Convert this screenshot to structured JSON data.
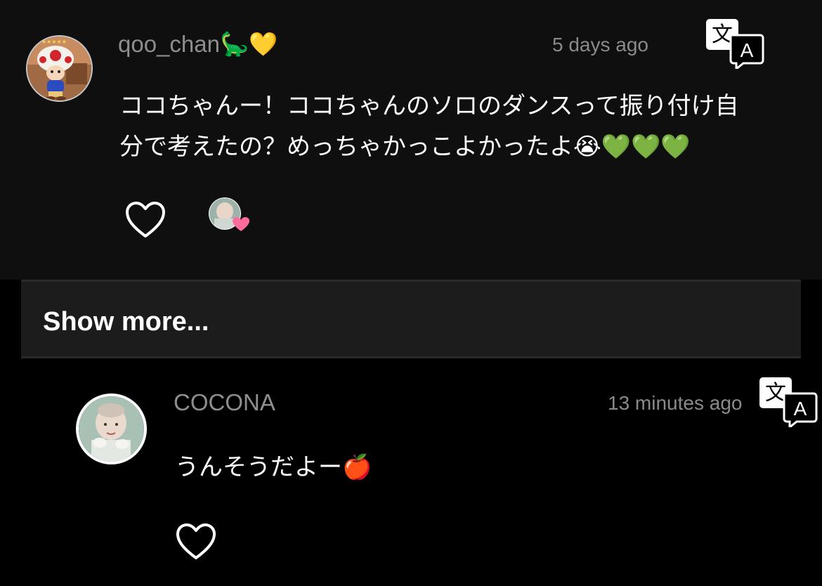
{
  "comment": {
    "username": "qoo_chan🦕💛",
    "timestamp": "5 days ago",
    "text_line1": "ココちゃんー！ココちゃんのソロのダンスって振り付け自",
    "text_line2": "分で考えたの？めっちゃかっこよかったよ😭💚💚💚",
    "avatar_icon": "toad-avatar",
    "translate_icon": "translate-icon",
    "like_icon": "heart-outline-icon",
    "liked_by_icon": "liked-by-avatar-with-pink-heart"
  },
  "show_more": {
    "label": "Show more..."
  },
  "reply": {
    "username": "COCONA",
    "timestamp": "13 minutes ago",
    "text": "うんそうだよー🍎",
    "avatar_icon": "cocona-avatar",
    "translate_icon": "translate-icon",
    "like_icon": "heart-outline-icon"
  },
  "colors": {
    "top_background": "#0f0f10",
    "show_more_background": "#1c1c1c",
    "reply_background": "#000000",
    "meta_text": "#8e8e8e",
    "pink_heart": "#ff6b9d"
  }
}
